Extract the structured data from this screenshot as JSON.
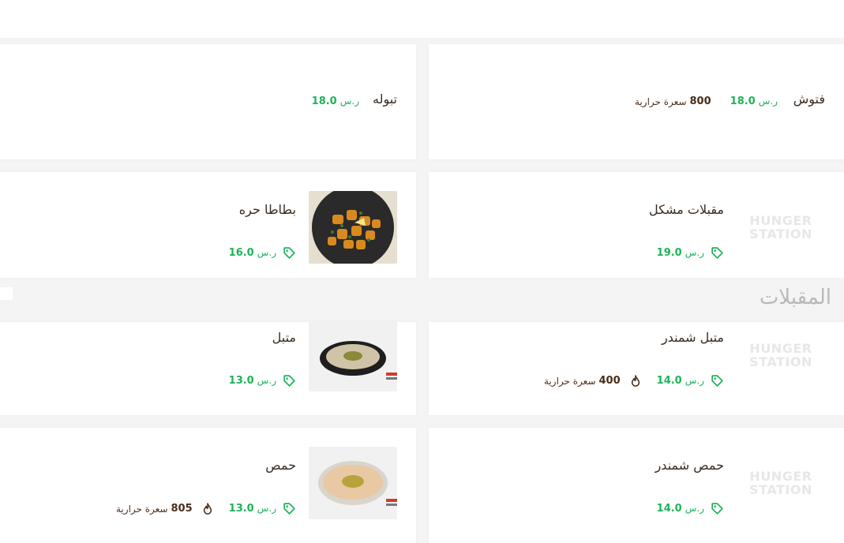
{
  "section": {
    "title": "المقبلات"
  },
  "currency": "ر.س",
  "calorie_unit": "سعرة حرارية",
  "placeholder": {
    "line1": "HUNGER",
    "line2": "STATION"
  },
  "items": {
    "fattoush": {
      "name": "فتوش",
      "price": "18.0",
      "calories": "800"
    },
    "tabbouleh": {
      "name": "تبوله",
      "price": "18.0"
    },
    "mixed_appetizers": {
      "name": "مقبلات مشكل",
      "price": "19.0"
    },
    "spicy_potatoes": {
      "name": "بطاطا حره",
      "price": "16.0"
    },
    "beet_mutabbal": {
      "name": "متبل شمندر",
      "price": "14.0",
      "calories": "400"
    },
    "mutabbal": {
      "name": "متبل",
      "price": "13.0"
    },
    "beet_hummus": {
      "name": "حمص شمندر",
      "price": "14.0"
    },
    "hummus": {
      "name": "حمص",
      "price": "13.0",
      "calories": "805"
    }
  },
  "colors": {
    "price": "#1fb25a",
    "name": "#3a2a1e",
    "section_title": "#b8b8b8",
    "calories": "#4a2e1a"
  },
  "icons": {
    "price": "tag-icon",
    "calories": "flame-icon"
  }
}
